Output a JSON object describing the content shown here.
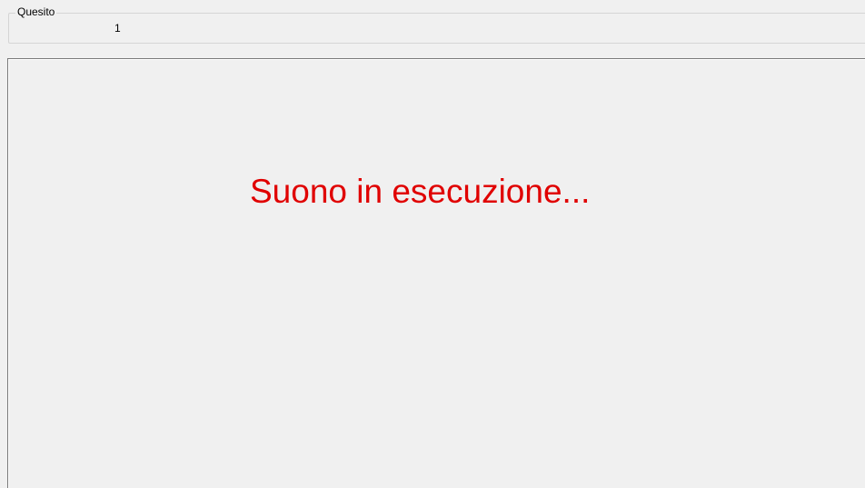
{
  "question_group": {
    "label": "Quesito",
    "number": "1"
  },
  "main": {
    "status_message": "Suono in esecuzione..."
  },
  "colors": {
    "status_message": "#e00000",
    "background": "#f0f0f0"
  }
}
